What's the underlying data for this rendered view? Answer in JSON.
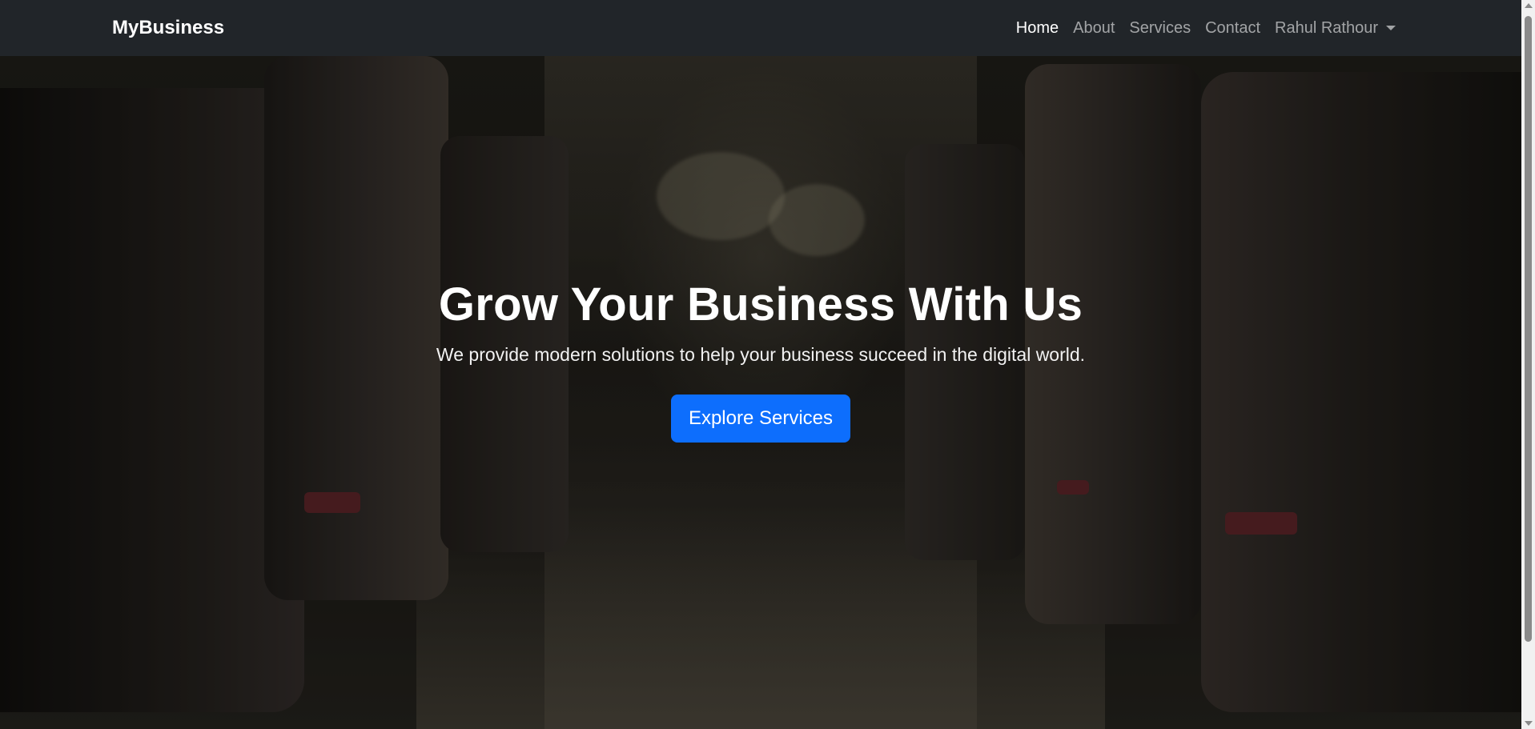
{
  "navbar": {
    "brand": "MyBusiness",
    "links": [
      {
        "label": "Home",
        "active": true
      },
      {
        "label": "About",
        "active": false
      },
      {
        "label": "Services",
        "active": false
      },
      {
        "label": "Contact",
        "active": false
      }
    ],
    "user_menu": {
      "label": "Rahul Rathour",
      "icon": "caret-down-icon"
    }
  },
  "hero": {
    "title": "Grow Your Business With Us",
    "subtitle": "We provide modern solutions to help your business succeed in the digital world.",
    "cta_label": "Explore Services",
    "background": "bus-interior-photo"
  },
  "colors": {
    "navbar_bg": "#212529",
    "primary": "#0d6efd",
    "text_light": "#ffffff",
    "link_muted": "rgba(255,255,255,0.58)"
  }
}
